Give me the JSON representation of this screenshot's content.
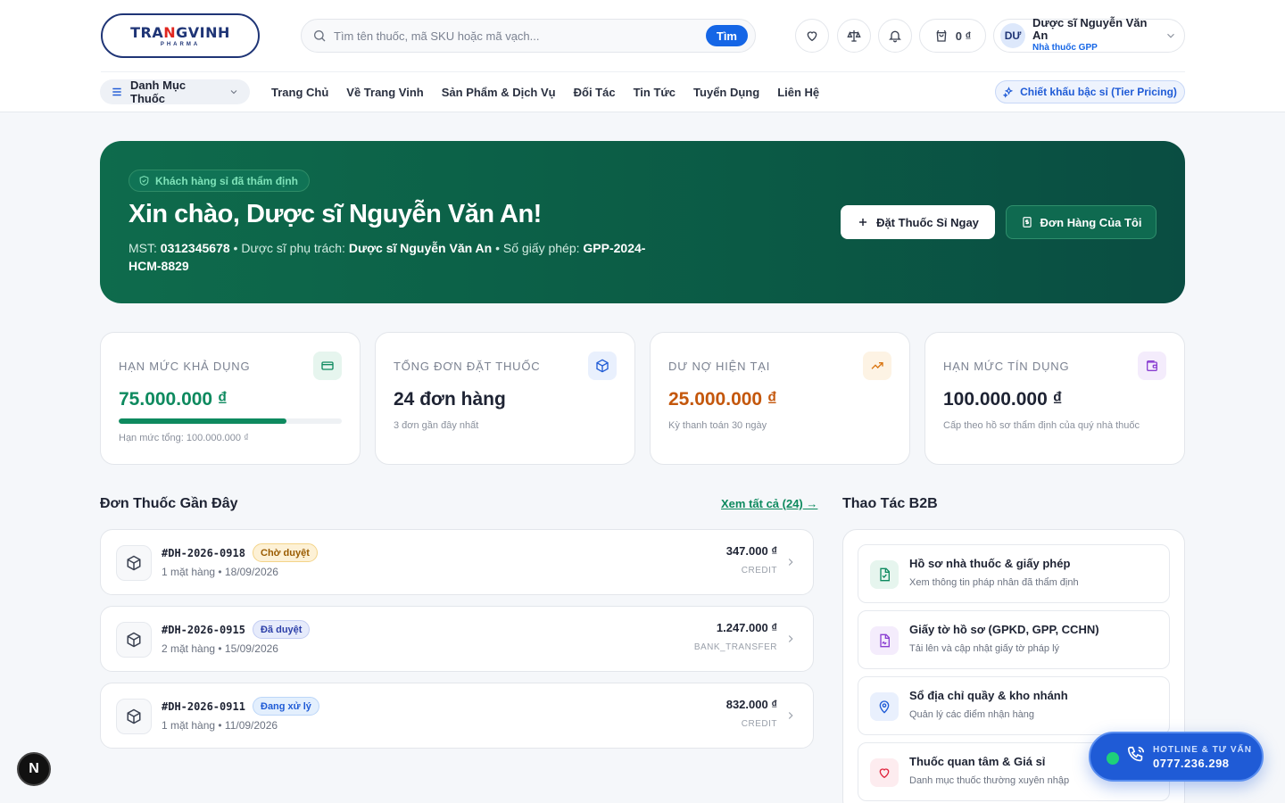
{
  "brand": {
    "logo_main_a": "TRA",
    "logo_main_red": "N",
    "logo_main_b": "GVINH",
    "logo_sub": "PHARMA"
  },
  "search": {
    "placeholder": "Tìm tên thuốc, mã SKU hoặc mã vạch...",
    "button": "Tìm"
  },
  "header_actions": {
    "cart_total": "0 ₫"
  },
  "user": {
    "initials": "DƯ",
    "name": "Dược sĩ Nguyễn Văn An",
    "role": "Nhà thuốc GPP"
  },
  "nav": {
    "category_label": "Danh Mục Thuốc",
    "items": [
      "Trang Chủ",
      "Về Trang Vinh",
      "Sản Phẩm & Dịch Vụ",
      "Đối Tác",
      "Tin Tức",
      "Tuyển Dụng",
      "Liên Hệ"
    ],
    "tier_pricing": "Chiết khấu bậc sỉ (Tier Pricing)"
  },
  "hero": {
    "verified": "Khách hàng sỉ đã thẩm định",
    "title": "Xin chào, Dược sĩ Nguyễn Văn An!",
    "mst_label": "MST:",
    "mst_value": "0312345678",
    "pharmacist_label": "• Dược sĩ phụ trách:",
    "pharmacist_value": "Dược sĩ Nguyễn Văn An",
    "license_label": "• Số giấy phép:",
    "license_value": "GPP-2024-HCM-8829",
    "order_now": "Đặt Thuốc Sỉ Ngay",
    "my_orders": "Đơn Hàng Của Tôi"
  },
  "stats": [
    {
      "label": "HẠN MỨC KHẢ DỤNG",
      "value": "75.000.000 ₫",
      "sub": "Hạn mức tổng: 100.000.000 ₫",
      "progress": 0.75,
      "color": "#0e8a5f"
    },
    {
      "label": "TỔNG ĐƠN ĐẶT THUỐC",
      "value": "24 đơn hàng",
      "sub": "3 đơn gần đây nhất",
      "color": "#1e2333"
    },
    {
      "label": "DƯ NỢ HIỆN TẠI",
      "value": "25.000.000 ₫",
      "sub": "Kỳ thanh toán 30 ngày",
      "color": "#c4570c"
    },
    {
      "label": "HẠN MỨC TÍN DỤNG",
      "value": "100.000.000 ₫",
      "sub": "Cấp theo hồ sơ thẩm định của quý nhà thuốc",
      "color": "#1e2333"
    }
  ],
  "orders": {
    "title": "Đơn Thuốc Gần Đây",
    "see_all": "Xem tất cả (24)",
    "items": [
      {
        "id": "#DH-2026-0918",
        "status": "Chờ duyệt",
        "meta": "1 mặt hàng • 18/09/2026",
        "amount": "347.000 ₫",
        "payment": "CREDIT"
      },
      {
        "id": "#DH-2026-0915",
        "status": "Đã duyệt",
        "meta": "2 mặt hàng • 15/09/2026",
        "amount": "1.247.000 ₫",
        "payment": "BANK_TRANSFER"
      },
      {
        "id": "#DH-2026-0911",
        "status": "Đang xử lý",
        "meta": "1 mặt hàng • 11/09/2026",
        "amount": "832.000 ₫",
        "payment": "CREDIT"
      }
    ]
  },
  "b2b": {
    "title": "Thao Tác B2B",
    "items": [
      {
        "title": "Hồ sơ nhà thuốc & giấy phép",
        "desc": "Xem thông tin pháp nhân đã thẩm định"
      },
      {
        "title": "Giấy tờ hồ sơ (GPKD, GPP, CCHN)",
        "desc": "Tải lên và cập nhật giấy tờ pháp lý"
      },
      {
        "title": "Sổ địa chỉ quầy & kho nhánh",
        "desc": "Quản lý các điểm nhận hàng"
      },
      {
        "title": "Thuốc quan tâm & Giá sỉ",
        "desc": "Danh mục thuốc thường xuyên nhập"
      }
    ]
  },
  "hotline": {
    "label": "HOTLINE & TƯ VẤN",
    "number": "0777.236.298"
  },
  "dev_badge": "N"
}
